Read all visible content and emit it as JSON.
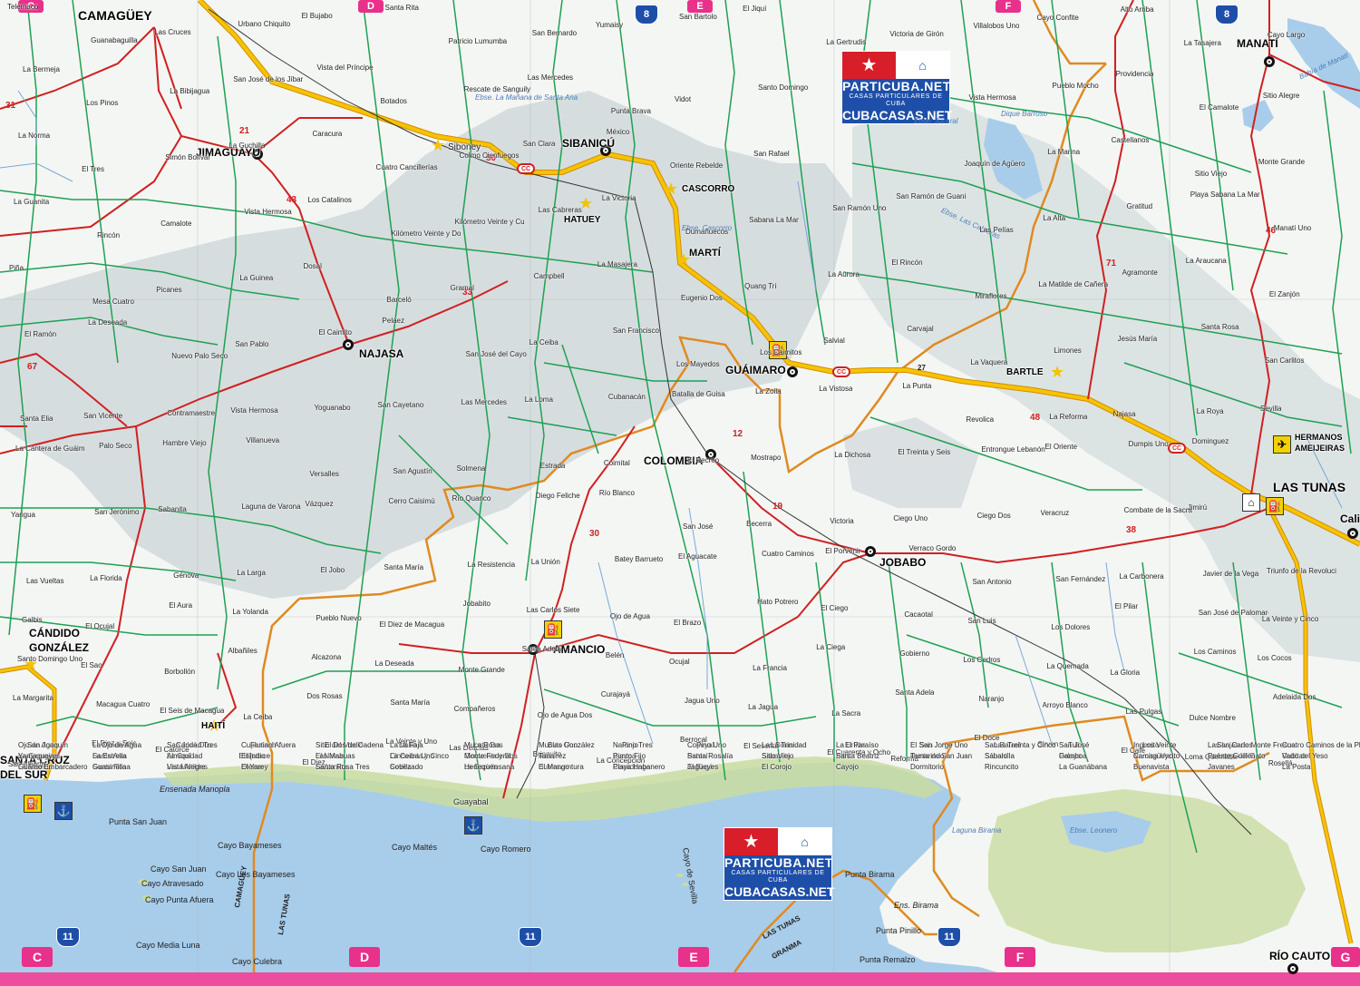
{
  "map": {
    "colors": {
      "sea": "#a8cdea",
      "land": "#f4f6f4",
      "shaded_relief": "#c9d3d6",
      "coast_green": "#c9dca0",
      "main_highway": "#f5c400",
      "red_road": "#d02020",
      "green_road": "#1fa052",
      "provincial_border": "#e08a20",
      "grid_magenta": "#e8318a",
      "highway_blue": "#1e4fa8"
    },
    "cities_major": [
      "CAMAGÜEY",
      "LAS TUNAS",
      "NAJASA",
      "COLOMBIA",
      "GUÁIMARO",
      "JOBABO",
      "AMANCIO",
      "SIBANICÚ",
      "JIMAGUAYÚ",
      "MANATÍ",
      "CÁNDIDO",
      "GONZÁLEZ",
      "SANTA CRUZ",
      "DEL SUR",
      "RÍO CAUTO",
      "Calix"
    ],
    "towns_star": [
      "Siboney",
      "HATUEY",
      "CASCORRO",
      "MARTÍ",
      "BARTLE",
      "HAITÍ"
    ],
    "airport": [
      "HERMANOS",
      "AMEIJEIRAS"
    ],
    "grid_letters": [
      "C",
      "D",
      "E",
      "F",
      "G"
    ],
    "highway_shields": [
      "8",
      "11"
    ],
    "road_numbers": [
      "31",
      "21",
      "43",
      "50",
      "33",
      "67",
      "12",
      "30",
      "19",
      "38",
      "48",
      "71",
      "46",
      "27"
    ],
    "cc_label": "CC",
    "watermark": {
      "name": "PARTICUBA.NET",
      "sub": "CASAS PARTICULARES DE CUBA",
      "name2": "CUBACASAS.NET"
    },
    "border_labels": [
      "CAMAGÜEY",
      "LAS TUNAS",
      "GRANMA"
    ],
    "sea_labels": [
      "Ensenada Manopla",
      "Punta San Juan",
      "Cayo Bayameses",
      "Cayo San Juan",
      "Cayo Atravesado",
      "Cayo Los Bayameses",
      "Cayo Punta Afuera",
      "Cayo Maltés",
      "Cayo Romero",
      "Cayo Media Luna",
      "Cayo Culebra",
      "Cayo de Sevilla",
      "Punta Birama",
      "Ens. Birama",
      "Punta Pinillo",
      "Punta Remalzo",
      "Guayabal"
    ],
    "water_labels": [
      "Ebse. Jucaral",
      "Dique Barroso",
      "Ebse. Las Cabreras",
      "Ebse. Cascorro",
      "Laguna Birama",
      "Ebse. Leonero",
      "Bahía de Manatí",
      "Laguna de Sevilla",
      "Ebse. La Mañana de Santa Ana"
    ],
    "places": [
      "Telemaco",
      "Guanabaguilla",
      "Las Cruces",
      "Urbano Chiquito",
      "El Bujabo",
      "Santa Rita",
      "Patricio Lumumba",
      "San Bernardo",
      "Yumaisy",
      "San Bartolo",
      "El Jiquí",
      "La Gertrudis",
      "Victoria de Girón",
      "Villalobos Uno",
      "Cayo Confite",
      "Alto Arriba",
      "La Tasajera",
      "Cayo Largo",
      "La Bermeja",
      "Los Pinos",
      "La Bibijagua",
      "San José de los Jíbaros",
      "Vista del Príncipe",
      "Botados",
      "Rescate de Sanguily",
      "Las Mercedes",
      "Punta Brava",
      "Vidot",
      "Santo Domingo",
      "Vista Hermosa",
      "Pueblo Mocho",
      "Providencia",
      "El Camalote",
      "Sitio Alegre",
      "La Norma",
      "El Tres",
      "Simón Bolívar",
      "La Guchilla",
      "Caracura",
      "Cuatro Cancillerías",
      "Colmo Cienfuegos",
      "San Clara",
      "México",
      "Oriente Rebelde",
      "San Rafael",
      "Joaquín de Agüero",
      "La Marina",
      "Castellanos",
      "Sitio Viejo",
      "Monte Grande",
      "La Guanita",
      "Rincón",
      "Camalote",
      "Vista Hermosa",
      "Los Catalinos",
      "Kilómetro Veinte y Dos",
      "Kilómetro Veinte y Cuatro",
      "Las Cabreras",
      "La Victoria",
      "Dumañuecos",
      "Sabana La Mar",
      "San Ramón Uno",
      "San Ramón de Guanito",
      "Las Pelías",
      "La Alta",
      "Gratitud",
      "Playa Sabana La Mar",
      "Manatí Uno",
      "Piña",
      "Mesa Cuatro",
      "Picanes",
      "La Guinea",
      "Dosal",
      "Barceló",
      "Gramal",
      "Campbell",
      "La Masajera",
      "Eugenio Dos",
      "Quang Tri",
      "La Aurora",
      "El Rincón",
      "Miraflores",
      "La Matilde de Cañera",
      "Agramonte",
      "La Araucana",
      "El Zanjón",
      "El Ramón",
      "La Deseada",
      "Nuevo Palo Seco",
      "San Pablo",
      "El Caimito",
      "Pelaez",
      "San José del Cayo",
      "La Ceiba",
      "San Francisco",
      "Los Mayedos",
      "Los Caimitos",
      "Salvial",
      "Carvajal",
      "La Vaquera",
      "Limones",
      "Jesús María",
      "Santa Rosa",
      "San Carlitos",
      "Santa Elia",
      "San Vicente",
      "Contramaestre",
      "Vista Hermosa",
      "Yoguanabo",
      "San Cayetano",
      "Las Mercedes",
      "La Loma",
      "Cubanacán",
      "Batalla de Guisa",
      "La Zoila",
      "La Vistosa",
      "La Punta",
      "Revolica",
      "La Reforma",
      "Najasa",
      "La Roya",
      "Sevilla",
      "La Cantera de Guáimaro",
      "Palo Seco",
      "Hambre Viejo",
      "Villanueva",
      "Versalles",
      "San Agustín",
      "Solmena",
      "Estrada",
      "Coimital",
      "El Recreo",
      "Mostrapo",
      "La Dichosa",
      "El Treinta y Seis",
      "Entrongue Lebanón",
      "El Oriente",
      "Dumpis Uno",
      "Dominguez",
      "Yarigua",
      "San Jerónimo",
      "Sabanita",
      "Laguna de Varona",
      "Vázquez",
      "Cerro Caisimú",
      "Río Quanco",
      "Diego Feliche",
      "Río Blanco",
      "San José",
      "Becerra",
      "Victoria",
      "Ciego Uno",
      "Ciego Dos",
      "Veracruz",
      "Combate de la Sacra",
      "Jimirú",
      "Las Vueltas",
      "La Florida",
      "Génova",
      "La Larga",
      "El Jobo",
      "Santa María",
      "La Resistencia",
      "La Unión",
      "Batey Barrueto",
      "El Aguacate",
      "Cuatro Caminos",
      "El Porvenir",
      "Verraco Gordo",
      "San Antonio",
      "San Fernández",
      "La Carbonera",
      "Javier de la Vega",
      "Triunfo de la Revolución",
      "Galbis",
      "El Ocujal",
      "El Aura",
      "La Yolanda",
      "Pueblo Nuevo",
      "El Diez de Macagua",
      "Jobabito",
      "Las Carlos Siete",
      "Ojo de Agua",
      "El Brazo",
      "Hato Potrero",
      "El Ciego",
      "Cacaotal",
      "San Luis",
      "Los Dolores",
      "El Pilar",
      "San José de Palomares",
      "La Veinte y Cinco",
      "Santo Domingo Uno",
      "El Sao",
      "Borbollón",
      "Albañiles",
      "Alcazona",
      "La Deseada",
      "Monte Grande",
      "Santa Adela",
      "Belén",
      "Ocujal",
      "La Francia",
      "La Ciega",
      "Gobierno",
      "Los Cedros",
      "La Quemada",
      "La Gloria",
      "Los Caminos",
      "Los Cocos",
      "La Margarita",
      "Macagua Cuatro",
      "El Seis de Macagua",
      "La Ceiba",
      "Dos Rosas",
      "Santa María",
      "Compañeros",
      "Ojo de Agua Dos",
      "Curajayá",
      "Jagua Uno",
      "La Jagua",
      "La Sacra",
      "Santa Adela",
      "Naranjo",
      "Arroyo Blanco",
      "Las Pulgas",
      "Dulce Nombre",
      "Adelaida Dos",
      "San Alberto",
      "El Diez y Seis",
      "El Catorce",
      "El Quince",
      "El Diez",
      "La Veinte y Uno",
      "Las Delicias",
      "Brinquito",
      "La Concepción",
      "Berrocal",
      "El Sesenta",
      "El Cuarenta y Ocho",
      "Reforma",
      "El Doce",
      "Sirven",
      "El Café",
      "Loma Quemada",
      "Rosellá",
      "Ojo de Agua",
      "La Minerva",
      "San José Dos",
      "Cupertina Afuera",
      "Sitio del Medio",
      "La Vario",
      "Mucuto Dos",
      "Mucuto Uno",
      "Naranjo",
      "Copeyal",
      "Las Bolas",
      "La Unión",
      "El Seis",
      "San Rafael",
      "San José",
      "Ingenito",
      "Las Lajas de Monte Fresco",
      "Cuatro Caminos de la Playa",
      "La Georgina",
      "Santa Ana",
      "La Caridad",
      "Loreto",
      "El Nueve",
      "Cincuenta y Cinco",
      "Cincuenta y Dos",
      "Ramírez",
      "Birama",
      "Potosí",
      "Sabanita",
      "Pino",
      "Punta de San Juan",
      "Sabanilla",
      "Pelayo",
      "Narcisa Uno",
      "La Loma del Gato",
      "Cubitas",
      "La Riselda",
      "Santa Rosa",
      "Las Matildes",
      "Olema",
      "La Lomita",
      "Sevilla",
      "La Espiritusana",
      "Buenaventura",
      "Covadonga",
      "El Bagá",
      "El Corojo",
      "Cayojo",
      "Dormitorio",
      "Rincuncito",
      "La Guanábana",
      "Buenavista",
      "Javanes",
      "La Posta",
      "San Joaquín",
      "Ojo de Agua",
      "Caridad Tres",
      "Fluriach",
      "El Dos de Cadena",
      "La Faja",
      "La Rosa",
      "Blas González",
      "Pino Tres",
      "Pino Uno",
      "La Trinidad",
      "El Paraíso",
      "San Jorge Uno",
      "Las Treinta y Cinco",
      "Tuli",
      "Los Veinte",
      "San Carlos",
      "Yamagueyes",
      "La Estrella",
      "Almiquí",
      "El Indio",
      "Las Mabuas",
      "La Ceiba Uno",
      "Monte Federal",
      "Tana",
      "Punto Fijo",
      "Santa Rosalía",
      "Sitio Viejo",
      "Santa Beatriz",
      "Tamarindo",
      "Sábalo",
      "Gamboa",
      "Camagüeycito",
      "Puente Guillén",
      "Vado del Yeso",
      "Guamo Embarcadero",
      "Guasimilla",
      "Vista Alegre",
      "El Yarey",
      "Santa Rosa Tres",
      "Cobezado",
      "Henequen",
      "El Mango",
      "Playa Habanero",
      "Jagüeyes"
    ]
  }
}
